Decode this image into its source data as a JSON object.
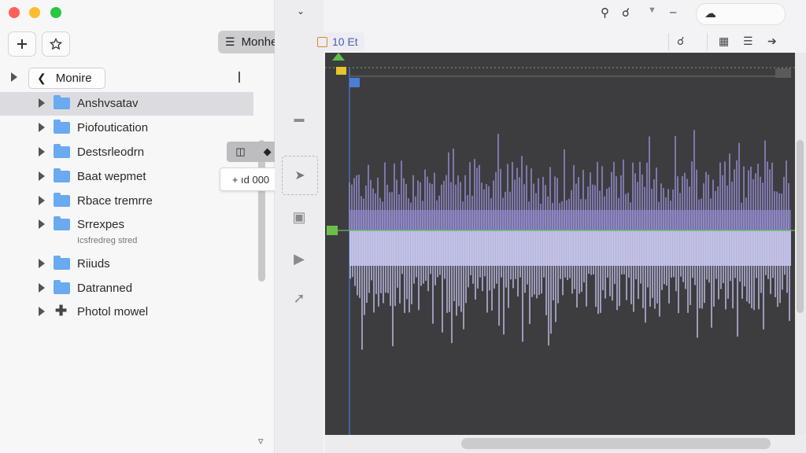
{
  "window": {
    "traffic_lights": [
      "#ff5f57",
      "#febc2e",
      "#28c840"
    ]
  },
  "sidebar": {
    "add_icon": "plus-icon",
    "favorite_icon": "star-icon",
    "mode_label": "Monhe",
    "nav_label": "Monire",
    "items": [
      {
        "label": "Anshvsatav",
        "selected": true,
        "type": "folder"
      },
      {
        "label": "Piofoutication",
        "selected": false,
        "type": "folder"
      },
      {
        "label": "Destsrleodrn",
        "selected": false,
        "type": "folder"
      },
      {
        "label": "Baat wepmet",
        "selected": false,
        "type": "folder"
      },
      {
        "label": "Rbace tremrre",
        "selected": false,
        "type": "folder"
      },
      {
        "label": "Srrexpes",
        "selected": false,
        "type": "folder",
        "sublabel": "Icsfredreg stred"
      },
      {
        "label": "Riiuds",
        "selected": false,
        "type": "folder"
      },
      {
        "label": "Datranned",
        "selected": false,
        "type": "folder"
      },
      {
        "label": "Photol mowel",
        "selected": false,
        "type": "plus"
      }
    ]
  },
  "popups": {
    "zoom_label": "+ ıd 000"
  },
  "tab": {
    "label": "10 Et"
  },
  "colors": {
    "waveform_top": "#9a92d8",
    "waveform_bottom": "#c5c4ec",
    "canvas_bg": "#3d3d40",
    "marker_green": "#4caf50",
    "marker_yellow": "#e8c52a",
    "playhead_blue": "#4a7fd6"
  }
}
